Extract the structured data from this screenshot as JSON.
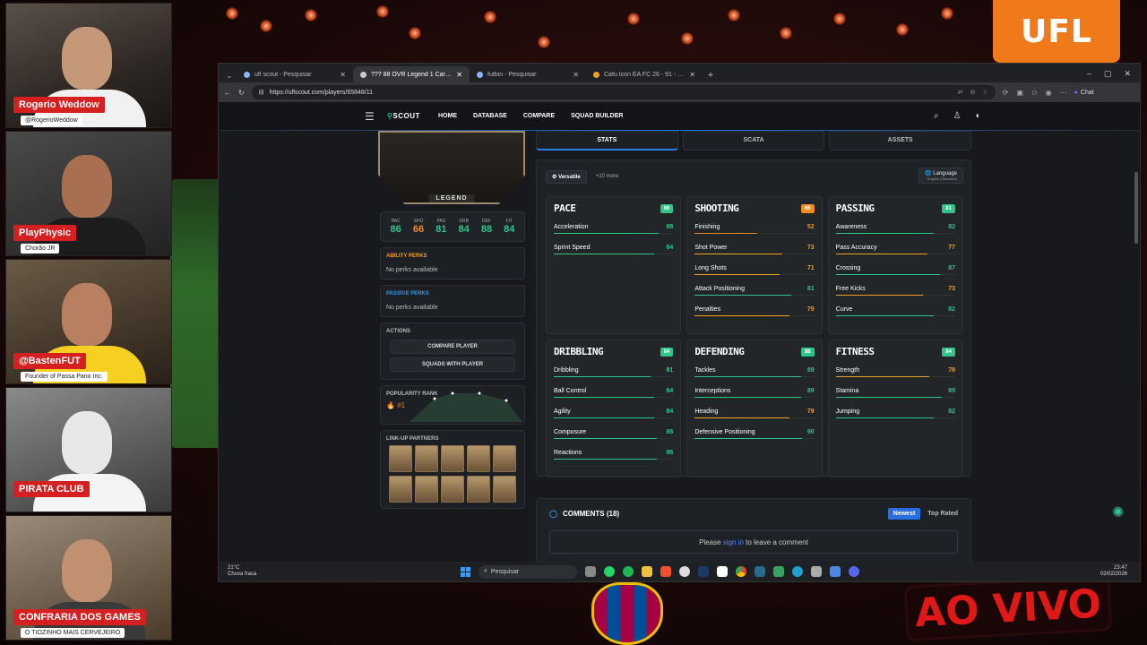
{
  "overlay": {
    "logo_text": "UFL",
    "live_text": "AO VIVO"
  },
  "webcams": [
    {
      "name": "Rogerio Weddow",
      "handle": "@RogerioWeddow",
      "shirt": "#f1f1f1",
      "bg": "#4a4036"
    },
    {
      "name": "PlayPhysic",
      "handle": "Chorão JR",
      "shirt": "#1c1c1c",
      "bg": "#3a3a3a"
    },
    {
      "name": "@BastenFUT",
      "handle": "Founder of Passa Pano Inc.",
      "shirt": "#f5d020",
      "bg": "#5a4a36"
    },
    {
      "name": "PIRATA CLUB",
      "handle": "",
      "shirt": "#f4f4f4",
      "bg": "#6a6a6a"
    },
    {
      "name": "CONFRARIA DOS GAMES",
      "handle": "O TIOZINHO MAIS CERVEJEIRO",
      "shirt": "#3a3a3a",
      "bg": "#7a6a5a"
    }
  ],
  "browser": {
    "tabs": [
      {
        "title": "ufl scout - Pesquisar",
        "active": false
      },
      {
        "title": "??? 88 OVR Legend 1 Card | UFL S",
        "active": true
      },
      {
        "title": "futbin - Pesquisar",
        "active": false
      },
      {
        "title": "Cafu Icon EA FC 26 - 91 - Rating a",
        "active": false
      }
    ],
    "url": "https://uflscout.com/players/65848/11",
    "chat_label": "Chat"
  },
  "site": {
    "logo": "SCOUT",
    "nav": [
      "HOME",
      "DATABASE",
      "COMPARE",
      "SQUAD BUILDER"
    ],
    "card": {
      "rarity": "LEGEND",
      "stats": [
        {
          "label": "PAC",
          "value": "86",
          "color": "#2ec48a"
        },
        {
          "label": "SHO",
          "value": "66",
          "color": "#f08a24"
        },
        {
          "label": "PAS",
          "value": "81",
          "color": "#2ec48a"
        },
        {
          "label": "DRB",
          "value": "84",
          "color": "#2ec48a"
        },
        {
          "label": "DEF",
          "value": "88",
          "color": "#2ec48a"
        },
        {
          "label": "FIT",
          "value": "84",
          "color": "#2ec48a"
        }
      ]
    },
    "ability_perks": {
      "title": "ABILITY PERKS",
      "text": "No perks available",
      "color": "#f0a020"
    },
    "passive_perks": {
      "title": "PASSIVE PERKS",
      "text": "No perks available",
      "color": "#2a9df4"
    },
    "actions": {
      "title": "ACTIONS",
      "compare": "COMPARE PLAYER",
      "squads": "SQUADS WITH PLAYER"
    },
    "popularity": {
      "title": "POPULARITY RANK",
      "rank": "#1"
    },
    "lineup": {
      "title": "LINK-UP PARTNERS"
    },
    "tabs": [
      "STATS",
      "SCATA",
      "ASSETS"
    ],
    "playstyle": {
      "name": "Versatile",
      "more": "+10 more"
    },
    "language": {
      "label": "Language",
      "value": "English (Standard)"
    },
    "categories": [
      {
        "name": "PACE",
        "rating": "86",
        "badge": "#2ec48a",
        "attrs": [
          {
            "name": "Acceleration",
            "value": 88
          },
          {
            "name": "Sprint Speed",
            "value": 84
          }
        ]
      },
      {
        "name": "SHOOTING",
        "rating": "66",
        "badge": "#f08a24",
        "attrs": [
          {
            "name": "Finishing",
            "value": 52
          },
          {
            "name": "Shot Power",
            "value": 73
          },
          {
            "name": "Long Shots",
            "value": 71
          },
          {
            "name": "Attack Positioning",
            "value": 81
          },
          {
            "name": "Penalties",
            "value": 79
          }
        ]
      },
      {
        "name": "PASSING",
        "rating": "81",
        "badge": "#2ec48a",
        "attrs": [
          {
            "name": "Awareness",
            "value": 82
          },
          {
            "name": "Pass Accuracy",
            "value": 77
          },
          {
            "name": "Crossing",
            "value": 87
          },
          {
            "name": "Free Kicks",
            "value": 73
          },
          {
            "name": "Curve",
            "value": 82
          }
        ]
      },
      {
        "name": "DRIBBLING",
        "rating": "84",
        "badge": "#2ec48a",
        "attrs": [
          {
            "name": "Dribbling",
            "value": 81
          },
          {
            "name": "Ball Control",
            "value": 84
          },
          {
            "name": "Agility",
            "value": 84
          },
          {
            "name": "Composure",
            "value": 86
          },
          {
            "name": "Reactions",
            "value": 86
          }
        ]
      },
      {
        "name": "DEFENDING",
        "rating": "88",
        "badge": "#2ec48a",
        "attrs": [
          {
            "name": "Tackles",
            "value": 89
          },
          {
            "name": "Interceptions",
            "value": 89
          },
          {
            "name": "Heading",
            "value": 79
          },
          {
            "name": "Defensive Positioning",
            "value": 90
          }
        ]
      },
      {
        "name": "FITNESS",
        "rating": "84",
        "badge": "#2ec48a",
        "attrs": [
          {
            "name": "Strength",
            "value": 78
          },
          {
            "name": "Stamina",
            "value": 89
          },
          {
            "name": "Jumping",
            "value": 82
          }
        ]
      }
    ],
    "comments": {
      "title": "COMMENTS (18)",
      "newest": "Newest",
      "top": "Top Rated",
      "login_pre": "Please",
      "login_link": "sign in",
      "login_post": "to leave a comment"
    }
  },
  "taskbar": {
    "temp": "21°C",
    "weather": "Chuva fraca",
    "search": "Pesquisar",
    "time": "23:47",
    "date": "02/02/2026"
  }
}
